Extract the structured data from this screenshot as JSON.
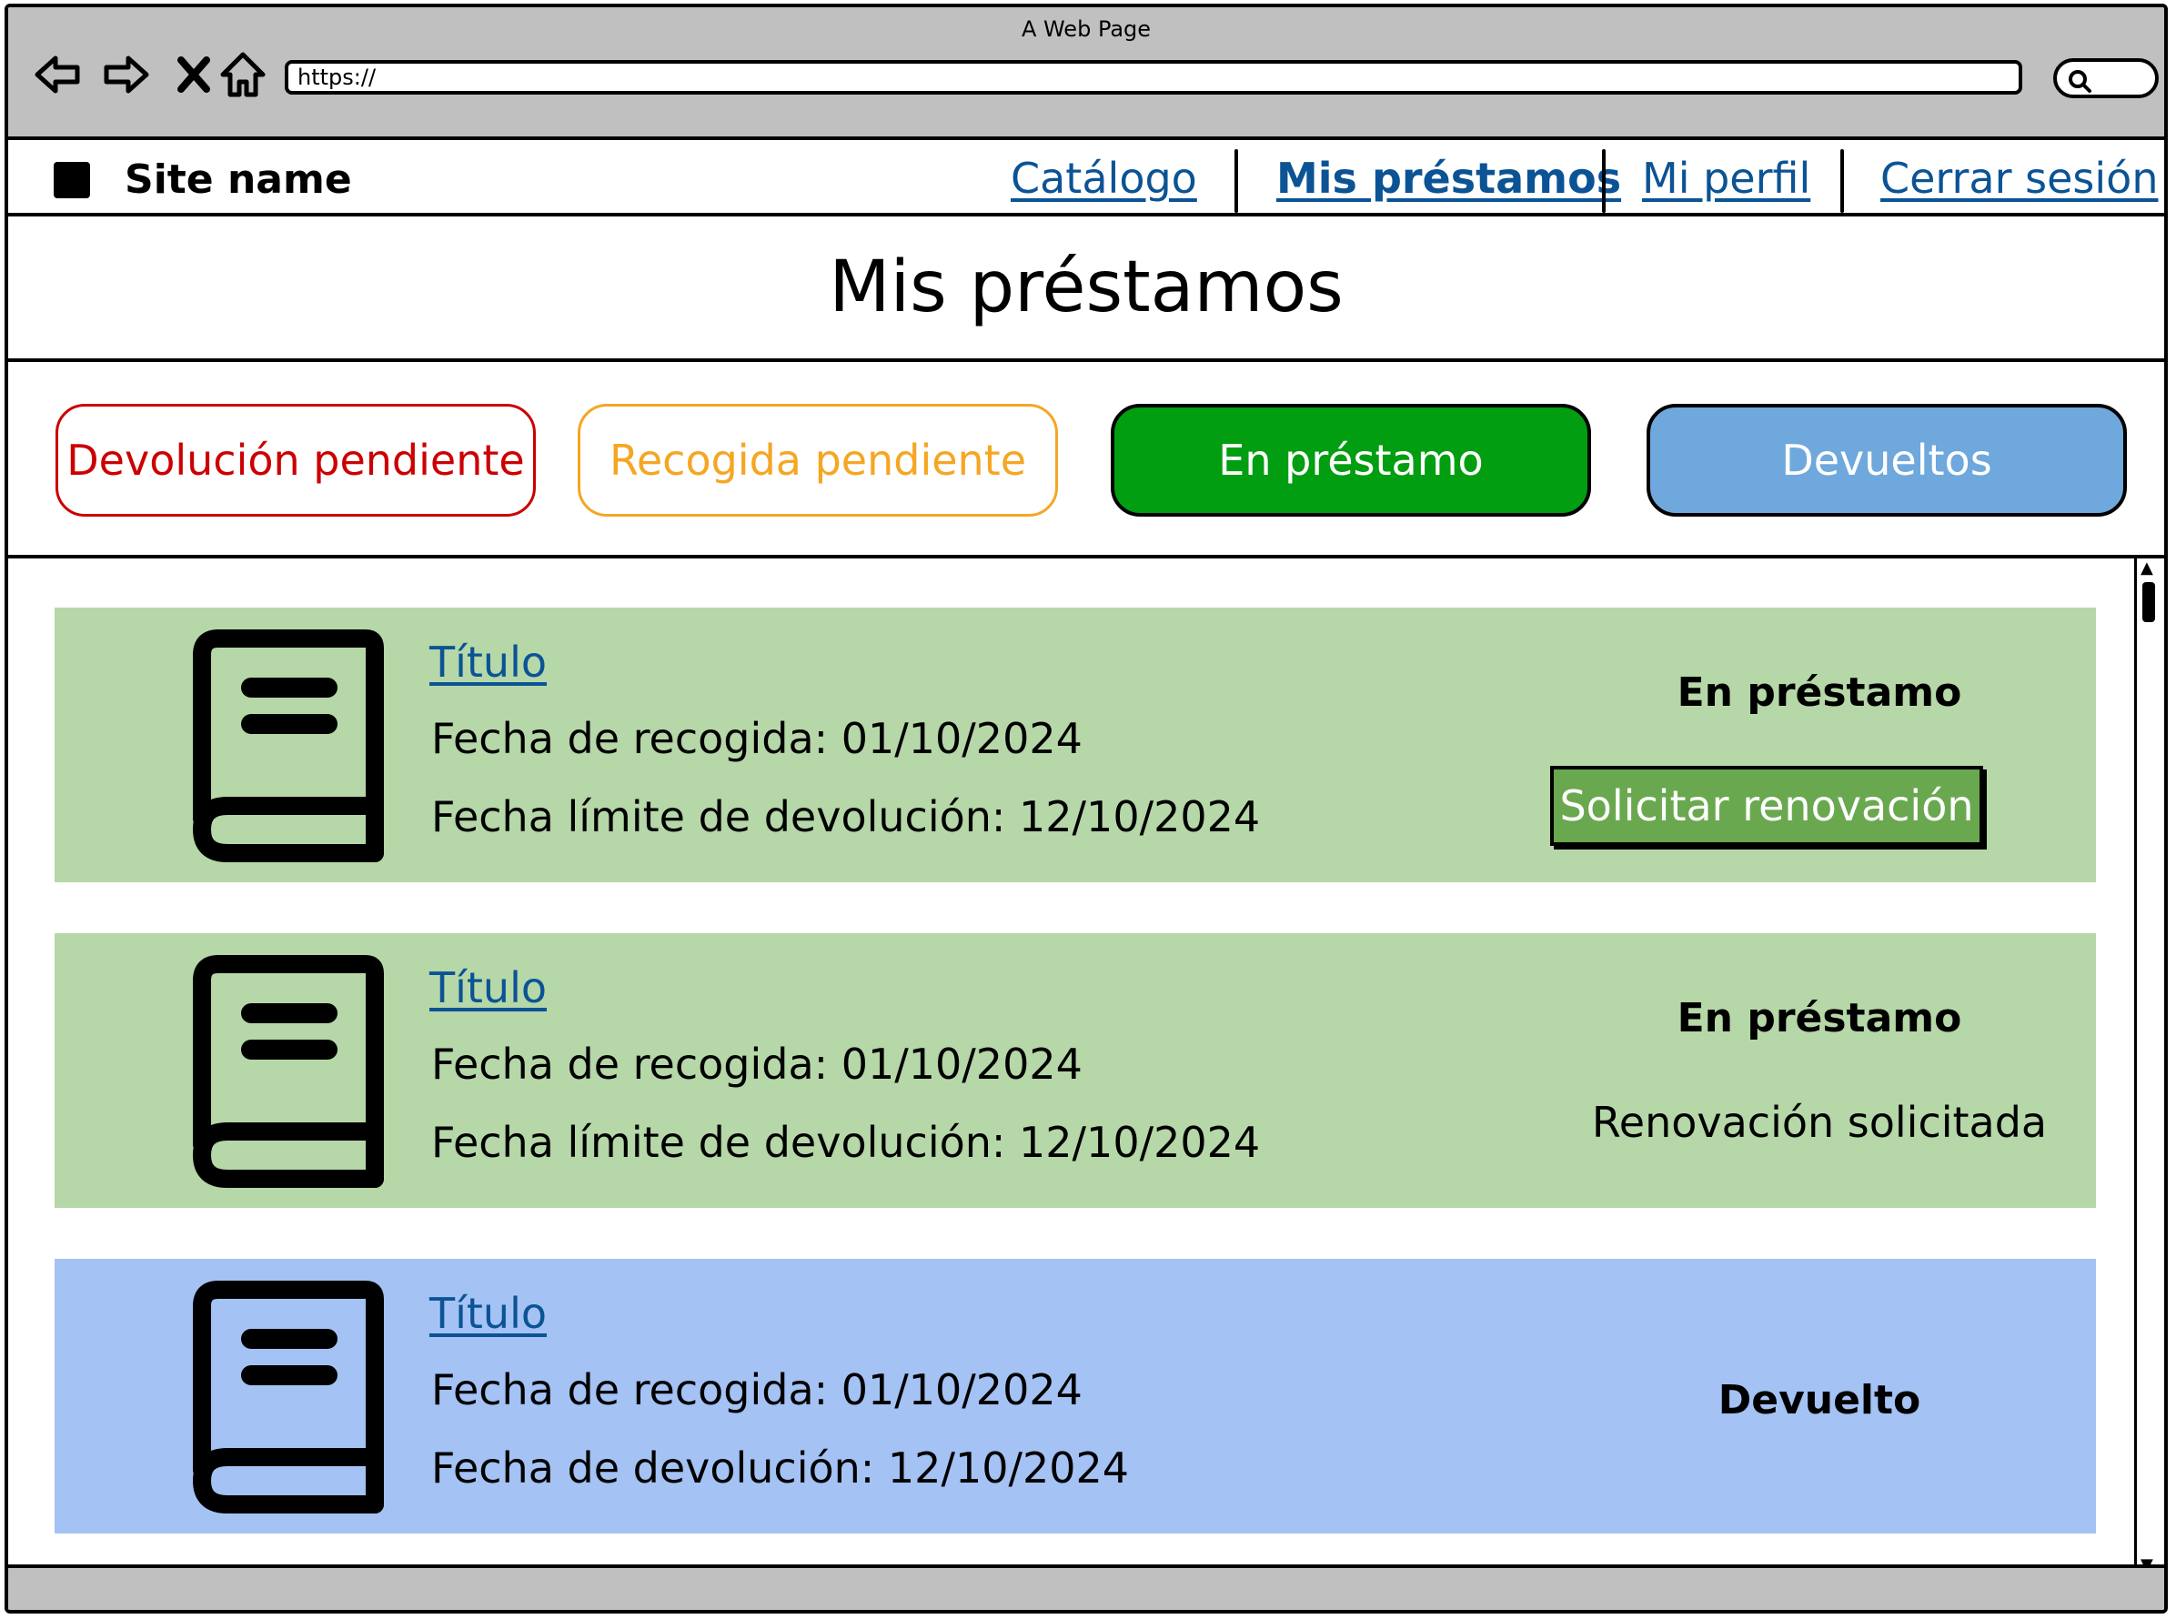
{
  "browser": {
    "window_title": "A Web Page",
    "url": "https://",
    "icons": [
      "back-arrow-icon",
      "forward-arrow-icon",
      "close-x-icon",
      "home-icon",
      "search-icon"
    ]
  },
  "site": {
    "name": "Site name",
    "nav": [
      {
        "label": "Catálogo",
        "active": false
      },
      {
        "label": "Mis préstamos",
        "active": true
      },
      {
        "label": "Mi perfil",
        "active": false
      },
      {
        "label": "Cerrar sesión",
        "active": false
      }
    ]
  },
  "page": {
    "title": "Mis préstamos"
  },
  "filters": [
    {
      "label": "Devolución pendiente",
      "color": "#cc0000",
      "style": "outline"
    },
    {
      "label": "Recogida pendiente",
      "color": "#f5a623",
      "style": "outline"
    },
    {
      "label": "En préstamo",
      "color": "#009e10",
      "style": "filled"
    },
    {
      "label": "Devueltos",
      "color": "#6fa8dc",
      "style": "filled"
    }
  ],
  "loans": [
    {
      "title": "Título",
      "line1": "Fecha de recogida: 01/10/2024",
      "line2": "Fecha límite de devolución: 12/10/2024",
      "status": "En préstamo",
      "action": "Solicitar renovación",
      "background": "#b6d7a8"
    },
    {
      "title": "Título",
      "line1": "Fecha de recogida: 01/10/2024",
      "line2": "Fecha límite de devolución: 12/10/2024",
      "status": "En préstamo",
      "note": "Renovación solicitada",
      "background": "#b6d7a8"
    },
    {
      "title": "Título",
      "line1": "Fecha de recogida: 01/10/2024",
      "line2": "Fecha de devolución: 12/10/2024",
      "status": "Devuelto",
      "background": "#a4c2f4"
    }
  ],
  "colors": {
    "link": "#0b5394",
    "chrome": "#c0c0c0",
    "action_button": "#6aa84f"
  }
}
